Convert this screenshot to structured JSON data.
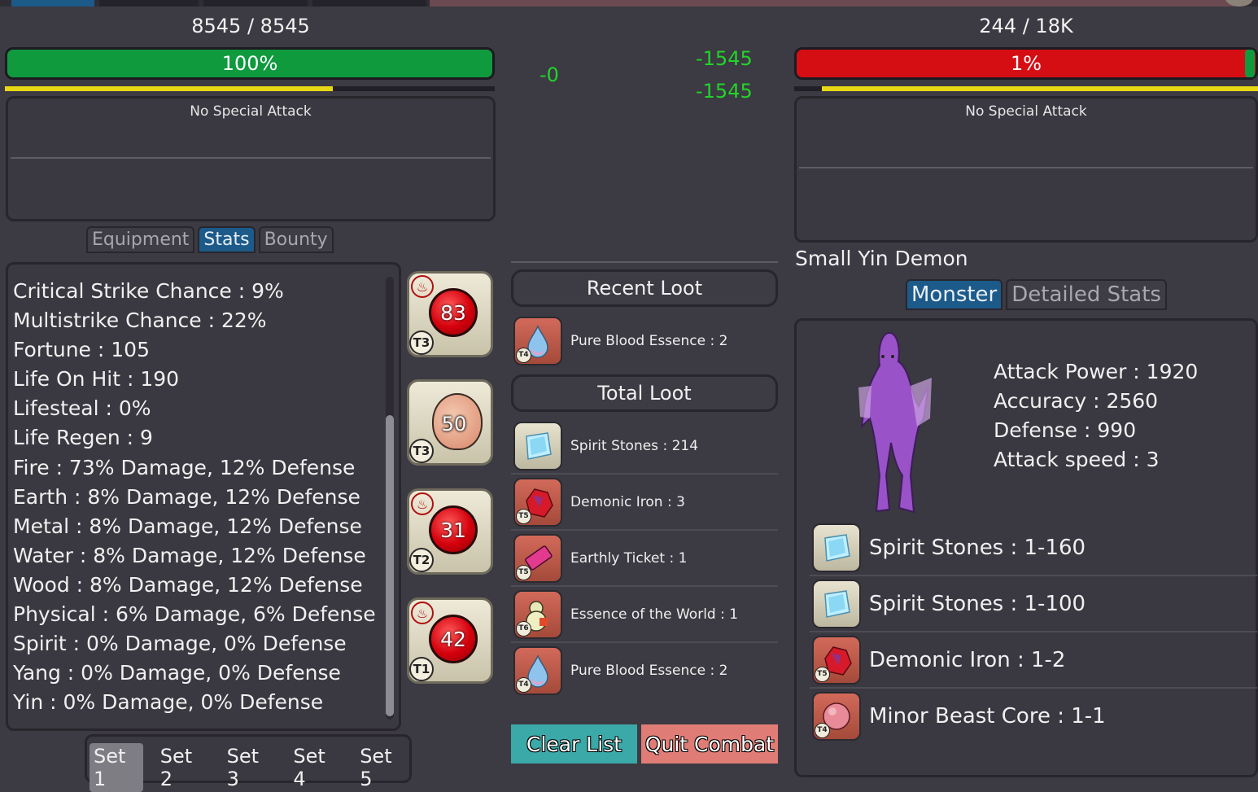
{
  "player": {
    "hp_text": "8545 / 8545",
    "hp_percent_label": "100%",
    "hp_fraction": 1.0,
    "energy_fraction": 0.67,
    "special_attack": "No Special Attack",
    "tabs": [
      "Equipment",
      "Stats",
      "Bounty"
    ],
    "active_tab": "Stats",
    "stats": [
      "Critical Strike Chance : 9%",
      "Multistrike Chance : 22%",
      "Fortune : 105",
      "Life On Hit : 190",
      "Lifesteal : 0%",
      "Life Regen : 9",
      "Fire : 73% Damage, 12% Defense",
      "Earth : 8% Damage, 12% Defense",
      "Metal : 8% Damage, 12% Defense",
      "Water : 8% Damage, 12% Defense",
      "Wood : 8% Damage, 12% Defense",
      "Physical : 6% Damage, 6% Defense",
      "Spirit : 0% Damage, 0% Defense",
      "Yang : 0% Damage, 0% Defense",
      "Yin : 0% Damage, 0% Defense"
    ],
    "sets": [
      "Set 1",
      "Set 2",
      "Set 3",
      "Set 4",
      "Set 5"
    ],
    "active_set": "Set 1"
  },
  "skills": [
    {
      "value": "83",
      "tier": "T3",
      "kind": "fire"
    },
    {
      "value": "50",
      "tier": "T3",
      "kind": "gourd"
    },
    {
      "value": "31",
      "tier": "T2",
      "kind": "fire"
    },
    {
      "value": "42",
      "tier": "T1",
      "kind": "fire"
    }
  ],
  "combat_numbers": {
    "player_damage": "-0",
    "enemy_damage_1": "-1545",
    "enemy_damage_2": "-1545"
  },
  "loot": {
    "recent_title": "Recent Loot",
    "recent": [
      {
        "name": "Pure Blood Essence : 2",
        "icon": "blood-drop-icon",
        "tier": "T4",
        "style": "rare"
      }
    ],
    "total_title": "Total Loot",
    "total": [
      {
        "name": "Spirit Stones : 214",
        "icon": "spirit-stone-icon",
        "tier": "",
        "style": "common"
      },
      {
        "name": "Demonic Iron : 3",
        "icon": "demonic-iron-icon",
        "tier": "T5",
        "style": "rare"
      },
      {
        "name": "Earthly Ticket : 1",
        "icon": "ticket-icon",
        "tier": "T5",
        "style": "rare"
      },
      {
        "name": "Essence of the World : 1",
        "icon": "gourd-icon",
        "tier": "T6",
        "style": "rare"
      },
      {
        "name": "Pure Blood Essence : 2",
        "icon": "blood-drop-icon",
        "tier": "T4",
        "style": "rare"
      }
    ],
    "clear_label": "Clear List",
    "quit_label": "Quit Combat"
  },
  "enemy": {
    "hp_text": "244 / 18K",
    "hp_percent_label": "1%",
    "hp_fraction": 0.01,
    "energy_fraction": 0.94,
    "special_attack": "No Special Attack",
    "name": "Small Yin Demon",
    "tabs": [
      "Monster",
      "Detailed Stats"
    ],
    "active_tab": "Monster",
    "stats": [
      "Attack Power : 1920",
      "Accuracy : 2560",
      "Defense : 990",
      "Attack speed : 3"
    ],
    "drops": [
      {
        "name": "Spirit Stones : 1-160",
        "icon": "spirit-stone-icon",
        "tier": "",
        "style": "common"
      },
      {
        "name": "Spirit Stones : 1-100",
        "icon": "spirit-stone-icon",
        "tier": "",
        "style": "common"
      },
      {
        "name": "Demonic Iron : 1-2",
        "icon": "demonic-iron-icon",
        "tier": "T5",
        "style": "rare"
      },
      {
        "name": "Minor Beast Core : 1-1",
        "icon": "beast-core-icon",
        "tier": "T4",
        "style": "rare"
      }
    ]
  },
  "colors": {
    "hp_green": "#0f9a3e",
    "hp_red": "#d50e14",
    "energy_yellow": "#e8d814",
    "tab_active": "#1c5a8a",
    "damage_green": "#22d42a",
    "clear_button": "#3aa9a8",
    "quit_button": "#e07c76"
  }
}
